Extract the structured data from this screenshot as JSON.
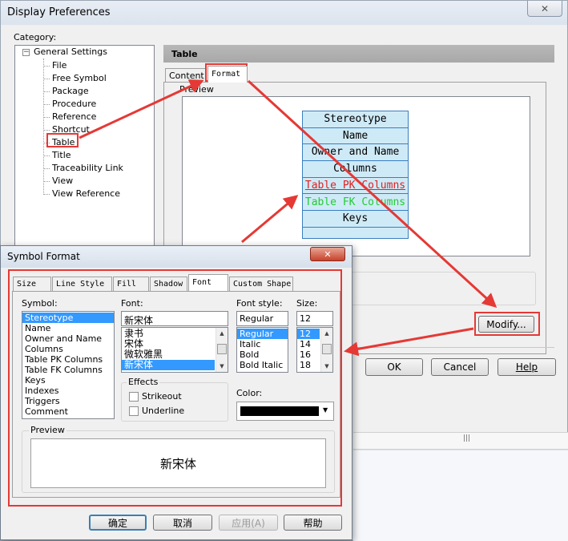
{
  "display_prefs": {
    "title": "Display Preferences",
    "category_label": "Category:",
    "tree_root": "General Settings",
    "tree_items": [
      "File",
      "Free Symbol",
      "Package",
      "Procedure",
      "Reference",
      "Shortcut",
      "Table",
      "Title",
      "Traceability Link",
      "View",
      "View Reference"
    ],
    "section_title": "Table",
    "tabs": [
      "Content",
      "Format"
    ],
    "preview_label": "Preview",
    "table_rows": [
      "Stereotype",
      "Name",
      "Owner and Name",
      "Columns",
      "Table PK Columns",
      "Table FK Columns",
      "Keys"
    ],
    "modify_button": "Modify...",
    "ok_button": "OK",
    "cancel_button": "Cancel",
    "help_button": "Help"
  },
  "symbol_format": {
    "title": "Symbol Format",
    "tabs": [
      "Size",
      "Line Style",
      "Fill",
      "Shadow",
      "Font",
      "Custom Shape"
    ],
    "symbol_label": "Symbol:",
    "symbols": [
      "Stereotype",
      "Name",
      "Owner and Name",
      "Columns",
      "Table PK Columns",
      "Table FK Columns",
      "Keys",
      "Indexes",
      "Triggers",
      "Comment"
    ],
    "font_label": "Font:",
    "font_value": "新宋体",
    "fonts": [
      "隶书",
      "宋体",
      "微软雅黑",
      "新宋体"
    ],
    "style_label": "Font style:",
    "style_value": "Regular",
    "styles": [
      "Regular",
      "Italic",
      "Bold",
      "Bold Italic"
    ],
    "size_label": "Size:",
    "size_value": "12",
    "sizes": [
      "12",
      "14",
      "16",
      "18"
    ],
    "effects_label": "Effects",
    "strikeout_label": "Strikeout",
    "underline_label": "Underline",
    "color_label": "Color:",
    "preview_label": "Preview",
    "preview_text": "新宋体",
    "confirm_button": "确定",
    "cancel_button": "取消",
    "apply_button": "应用(A)",
    "help_button": "帮助"
  },
  "colors": {
    "pk_text": "#e02020",
    "fk_text": "#22cc33",
    "table_fill": "#cfeaf7",
    "table_border": "#3a7ec0",
    "highlight": "#e53935"
  }
}
